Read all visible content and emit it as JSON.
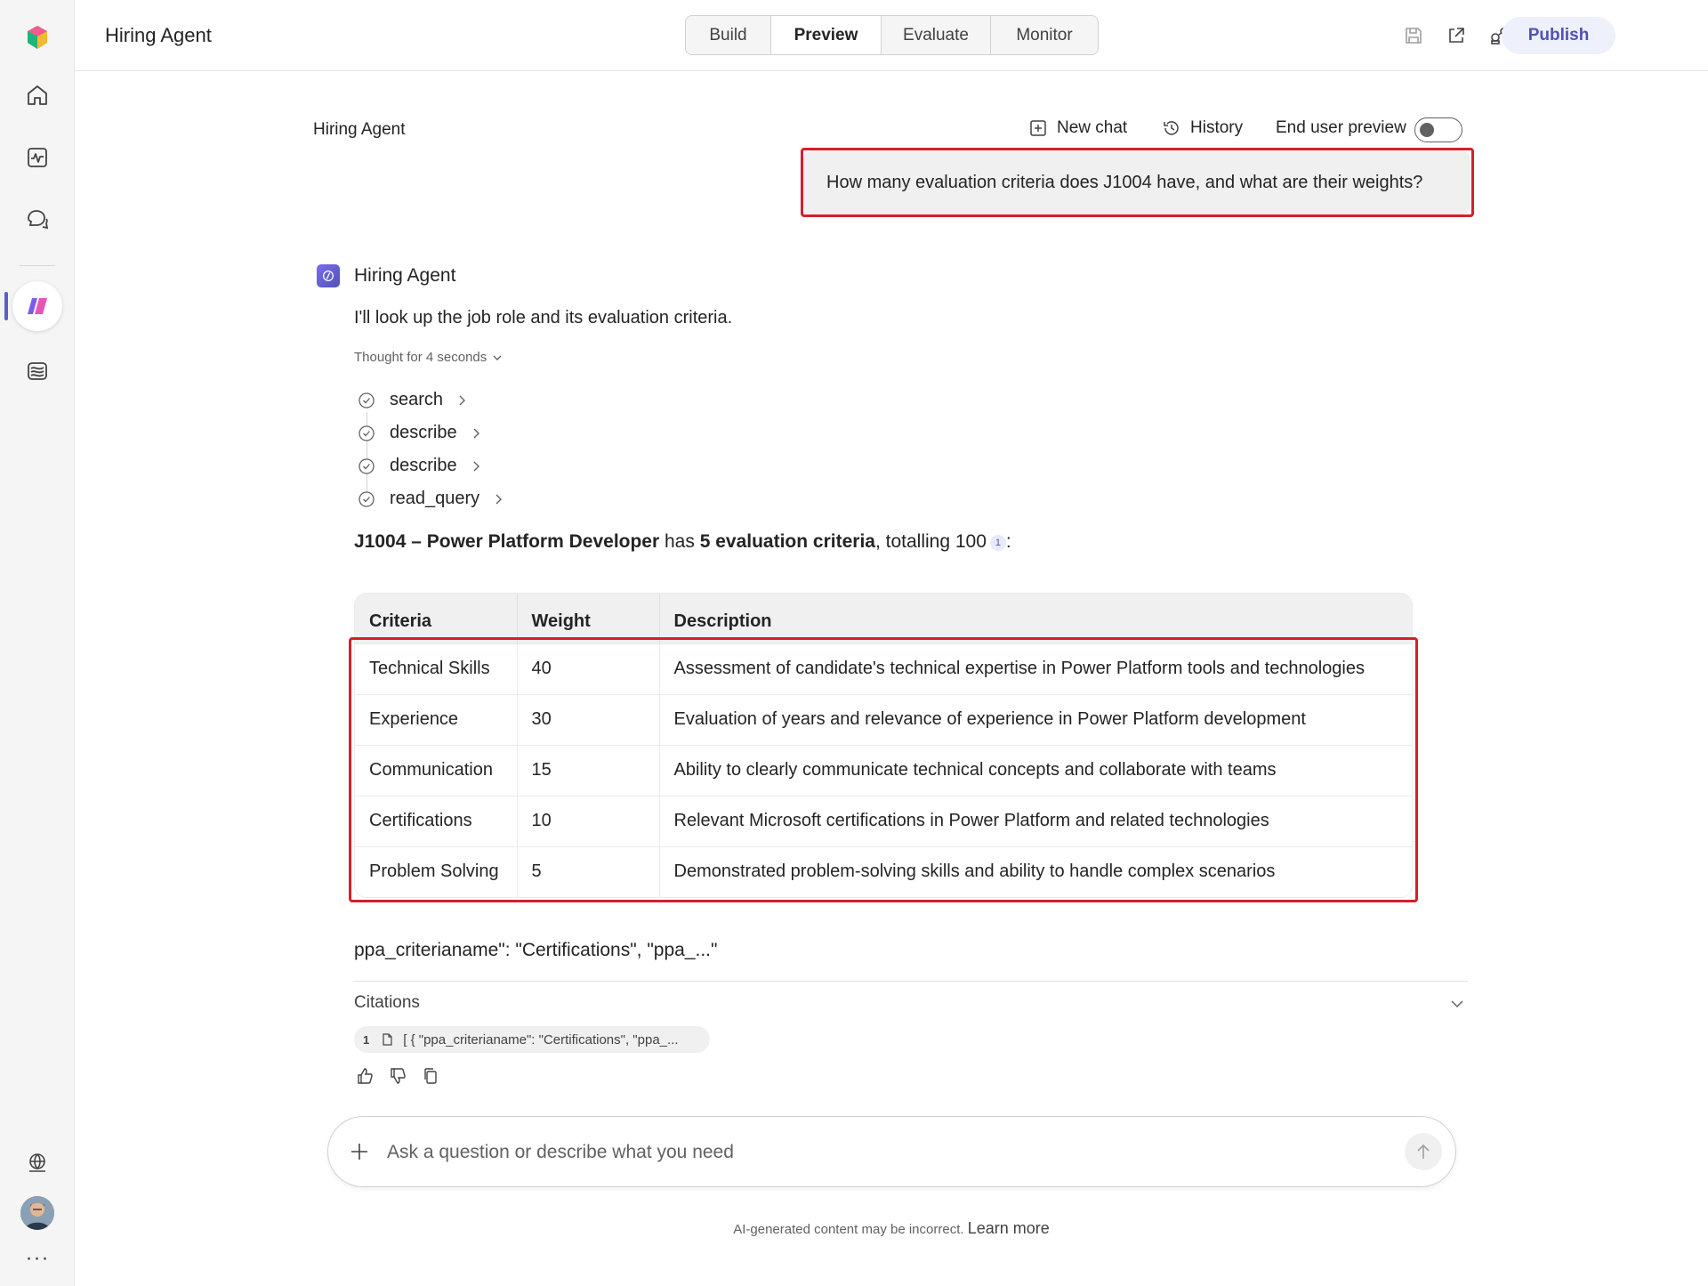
{
  "header": {
    "app_title": "Hiring Agent",
    "tabs": [
      {
        "label": "Build"
      },
      {
        "label": "Preview",
        "active": true
      },
      {
        "label": "Evaluate"
      },
      {
        "label": "Monitor"
      }
    ],
    "publish_label": "Publish"
  },
  "rail": {
    "icons": [
      "copilot-logo-icon",
      "home-icon",
      "activity-icon",
      "chat-icon",
      "agent-icon",
      "library-icon",
      "globe-icon",
      "avatar",
      "more-icon"
    ]
  },
  "chat": {
    "agent_name": "Hiring Agent",
    "new_chat_label": "New chat",
    "history_label": "History",
    "end_user_preview_label": "End user preview",
    "end_user_preview_on": false,
    "user_message": "How many evaluation criteria does J1004 have, and what are their weights?",
    "reply": {
      "author": "Hiring Agent",
      "intro": "I'll look up the job role and its evaluation criteria.",
      "thought": "Thought for 4 seconds",
      "steps": [
        "search",
        "describe",
        "describe",
        "read_query"
      ],
      "summary": {
        "role": "J1004 – Power Platform Developer",
        "has": " has ",
        "count": "5 evaluation criteria",
        "rest": ", totalling 100",
        "citation": "1",
        "end": ":"
      },
      "table": {
        "headers": [
          "Criteria",
          "Weight",
          "Description"
        ],
        "rows": [
          [
            "Technical Skills",
            "40",
            "Assessment of candidate's technical expertise in Power Platform tools and technologies"
          ],
          [
            "Experience",
            "30",
            "Evaluation of years and relevance of experience in Power Platform development"
          ],
          [
            "Communication",
            "15",
            "Ability to clearly communicate technical concepts and collaborate with teams"
          ],
          [
            "Certifications",
            "10",
            "Relevant Microsoft certifications in Power Platform and related technologies"
          ],
          [
            "Problem Solving",
            "5",
            "Demonstrated problem-solving skills and ability to handle complex scenarios"
          ]
        ]
      },
      "truncated_text": "ppa_criterianame\": \"Certifications\", \"ppa_...\"",
      "citations_label": "Citations",
      "citations": [
        {
          "number": "1",
          "text": "[ { \"ppa_criterianame\": \"Certifications\", \"ppa_..."
        }
      ]
    },
    "input_placeholder": "Ask a question or describe what you need",
    "disclaimer": "AI-generated content may be incorrect.",
    "learn_more": "Learn more"
  },
  "colors": {
    "accent": "#5b5fc7",
    "highlight": "#d4202a",
    "publish_text": "#4f52b2"
  }
}
